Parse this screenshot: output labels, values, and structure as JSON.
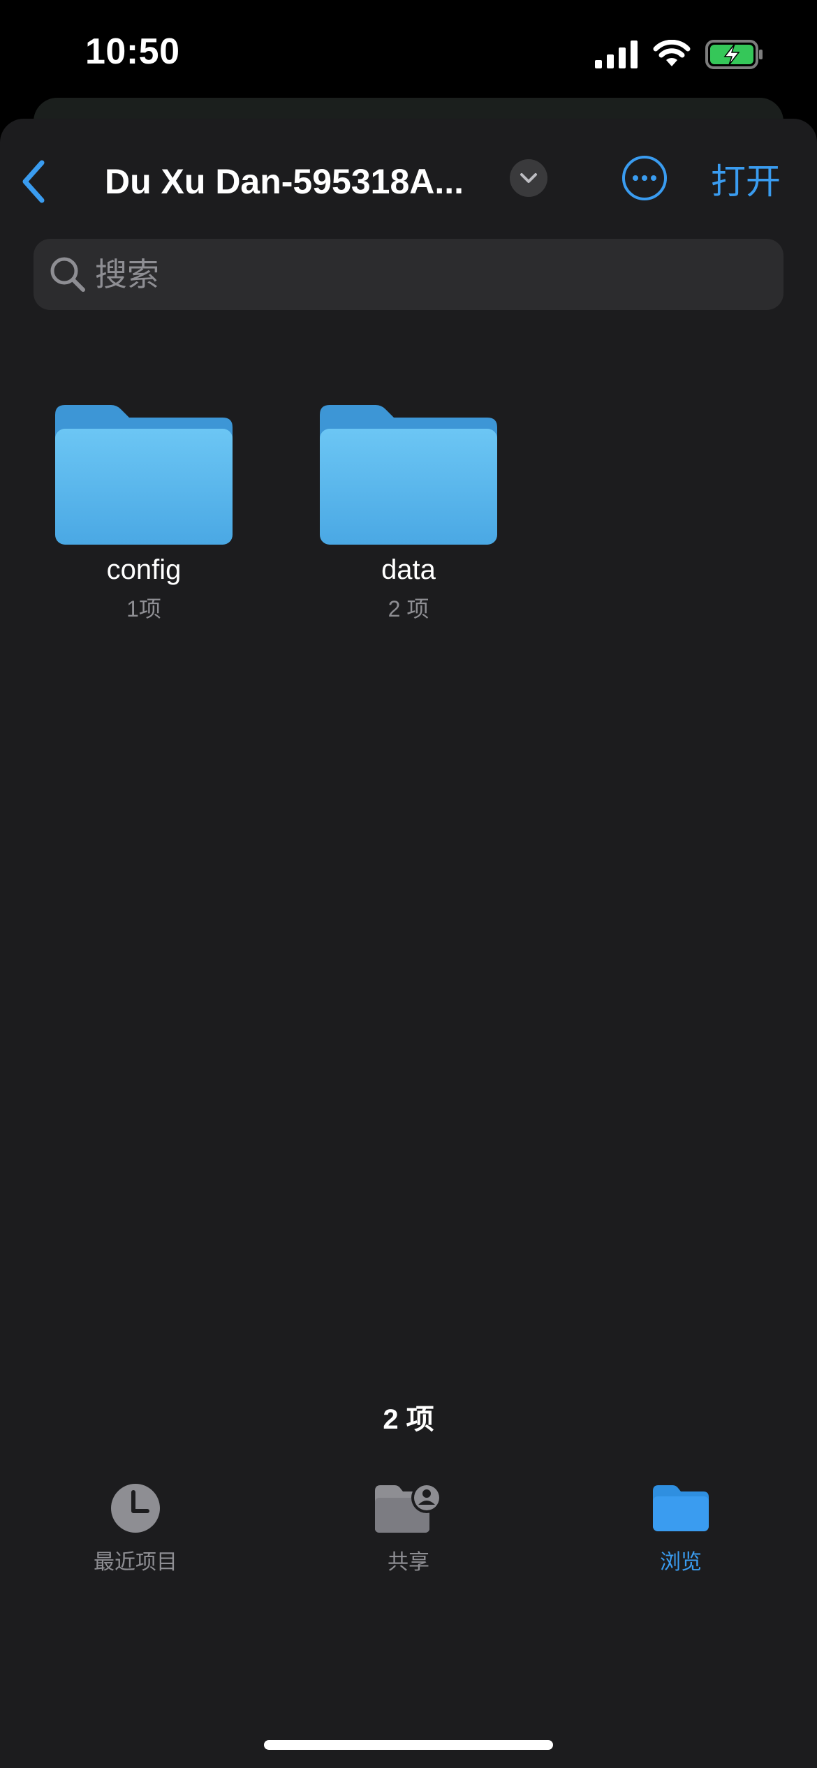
{
  "status_bar": {
    "time": "10:50"
  },
  "nav": {
    "title": "Du Xu Dan-595318A...",
    "open_label": "打开",
    "accent_color": "#3a9cf0"
  },
  "search": {
    "placeholder": "搜索",
    "value": ""
  },
  "folders": [
    {
      "name": "config",
      "count": "1项",
      "icon": "folder-icon"
    },
    {
      "name": "data",
      "count": "2 项",
      "icon": "folder-icon"
    }
  ],
  "footer": {
    "item_count": "2 项"
  },
  "tabs": [
    {
      "label": "最近项目",
      "icon": "clock-icon",
      "active": false
    },
    {
      "label": "共享",
      "icon": "shared-folder-icon",
      "active": false
    },
    {
      "label": "浏览",
      "icon": "folder-icon",
      "active": true
    }
  ],
  "colors": {
    "background": "#1c1c1e",
    "search_bg": "#2c2c2e",
    "inactive_tab": "#8e8e93",
    "active_tab": "#3a9cf0",
    "folder": "#5bb8ef"
  }
}
